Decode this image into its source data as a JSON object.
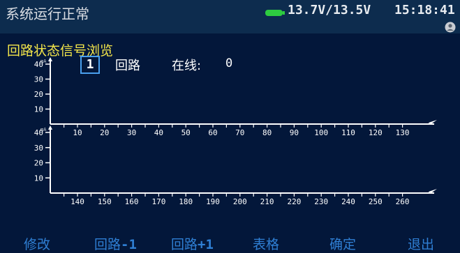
{
  "status": {
    "text": "系统运行正常",
    "voltage": "13.7V/13.5V",
    "time": "15:18:41",
    "battery_color": "#2ecc40",
    "icons": [
      "battery-icon",
      "user-icon"
    ]
  },
  "page": {
    "title": "回路状态信号浏览",
    "loop_number": "1",
    "loop_label": "回路",
    "online_label": "在线:",
    "online_count": "0"
  },
  "chart_data": [
    {
      "type": "bar",
      "unit_label": "mA",
      "y_ticks": [
        "40",
        "30",
        "20",
        "10"
      ],
      "ylim": [
        0,
        40
      ],
      "x_ticks": [
        "10",
        "20",
        "30",
        "40",
        "50",
        "60",
        "70",
        "80",
        "90",
        "100",
        "110",
        "120",
        "130"
      ],
      "xlim": [
        1,
        130
      ],
      "values": []
    },
    {
      "type": "bar",
      "unit_label": "mA",
      "y_ticks": [
        "40",
        "30",
        "20",
        "10"
      ],
      "ylim": [
        0,
        40
      ],
      "x_ticks": [
        "140",
        "150",
        "160",
        "170",
        "180",
        "190",
        "200",
        "210",
        "220",
        "230",
        "240",
        "250",
        "260"
      ],
      "xlim": [
        131,
        260
      ],
      "values": []
    }
  ],
  "softkeys": [
    {
      "name": "modify",
      "label": "修改",
      "suffix": ""
    },
    {
      "name": "loop-prev",
      "label": "回路",
      "suffix": "-1"
    },
    {
      "name": "loop-next",
      "label": "回路",
      "suffix": "+1"
    },
    {
      "name": "table",
      "label": "表格",
      "suffix": ""
    },
    {
      "name": "confirm",
      "label": "确定",
      "suffix": ""
    },
    {
      "name": "exit",
      "label": "退出",
      "suffix": ""
    }
  ]
}
